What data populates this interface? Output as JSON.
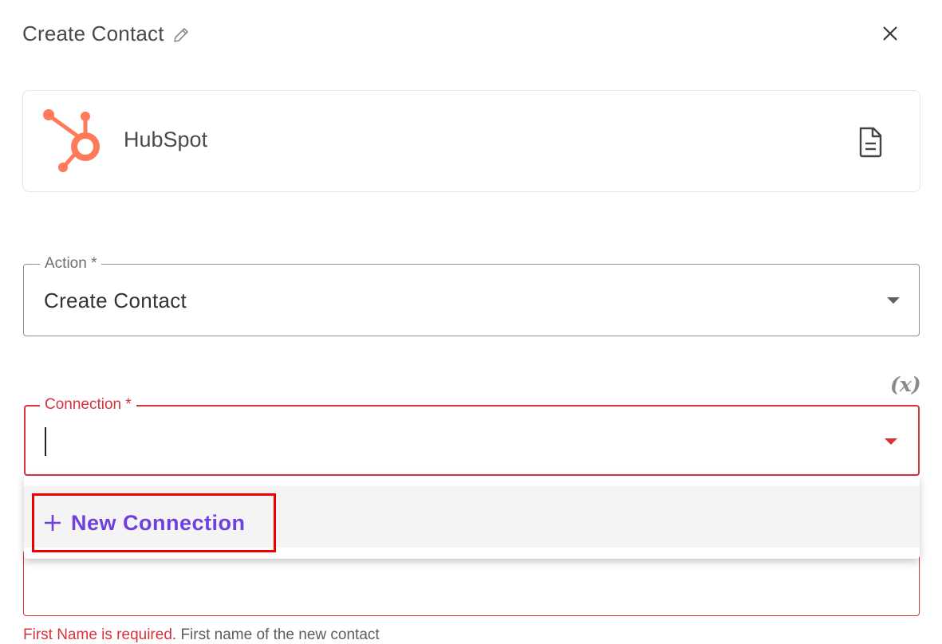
{
  "header": {
    "title": "Create Contact",
    "edit_icon": "pencil-icon",
    "close_icon": "close-icon"
  },
  "app": {
    "name": "HubSpot",
    "logo_icon": "hubspot-logo",
    "doc_icon": "document-icon",
    "brand_color": "#ff7a59"
  },
  "fields": {
    "action": {
      "label": "Action *",
      "value": "Create Contact"
    },
    "connection": {
      "label": "Connection *",
      "value": "",
      "variable_toggle": "(x)",
      "error_color": "#d6343d"
    },
    "first_name": {
      "error_text": "First Name is required",
      "help_text": ". First name of the new contact"
    }
  },
  "dropdown": {
    "items": [
      {
        "label": "New Connection",
        "icon": "plus-icon"
      }
    ],
    "accent_color": "#6f3fe0"
  }
}
